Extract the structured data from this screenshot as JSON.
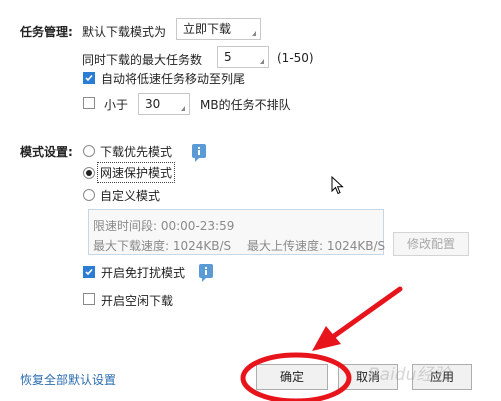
{
  "task": {
    "section_label": "任务管理:",
    "default_mode_label": "默认下载模式为",
    "default_mode_value": "立即下载",
    "max_tasks_label": "同时下载的最大任务数",
    "max_tasks_value": "5",
    "max_tasks_range": "(1-50)",
    "auto_move_label": "自动将低速任务移动至列尾",
    "auto_move_checked": true,
    "less_than_label": "小于",
    "less_than_checked": false,
    "less_than_value": "30",
    "less_than_suffix": "MB的任务不排队"
  },
  "mode": {
    "section_label": "模式设置:",
    "options": [
      {
        "label": "下载优先模式",
        "selected": false
      },
      {
        "label": "网速保护模式",
        "selected": true
      },
      {
        "label": "自定义模式",
        "selected": false
      }
    ],
    "speed_limit_period": "限速时间段:  00:00-23:59",
    "max_download_speed": "最大下载速度:  1024KB/S",
    "max_upload_speed": "最大上传速度:  1024KB/S",
    "modify_config_label": "修改配置",
    "no_disturb_label": "开启免打扰模式",
    "no_disturb_checked": true,
    "idle_download_label": "开启空闲下载",
    "idle_download_checked": false
  },
  "footer": {
    "restore_defaults_label": "恢复全部默认设置",
    "ok_label": "确定",
    "cancel_label": "取消",
    "apply_label": "应用"
  },
  "watermark": "Baidu经验",
  "colors": {
    "accent": "#2b7cd3",
    "annotation_red": "#e8141b",
    "link": "#2b6cb0"
  }
}
